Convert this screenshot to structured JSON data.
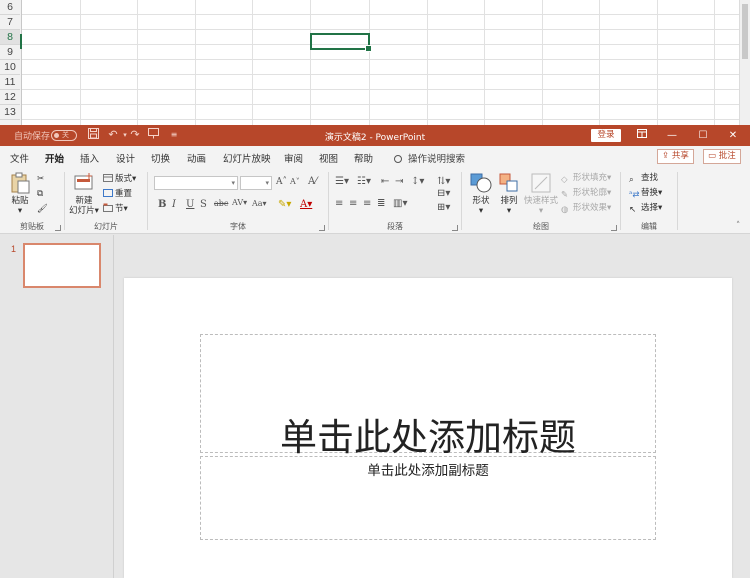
{
  "excel": {
    "rows": [
      "6",
      "7",
      "8",
      "9",
      "10",
      "11",
      "12",
      "13"
    ],
    "active_row": "8"
  },
  "ppt": {
    "autosave_label": "自动保存",
    "autosave_state": "关",
    "doc_title": "演示文稿2  -  PowerPoint",
    "login_label": "登录",
    "tabs": [
      "文件",
      "开始",
      "插入",
      "设计",
      "切换",
      "动画",
      "幻灯片放映",
      "审阅",
      "视图",
      "帮助"
    ],
    "active_tab": "开始",
    "tell_me": "操作说明搜索",
    "share_label": "共享",
    "comments_label": "批注",
    "accent_color": "#b7472a",
    "ribbon": {
      "clipboard": {
        "name": "剪贴板",
        "paste": "粘贴"
      },
      "slides": {
        "name": "幻灯片",
        "new_slide_1": "新建",
        "new_slide_2": "幻灯片",
        "layout": "版式",
        "reset": "重置",
        "section": "节"
      },
      "font": {
        "name": "字体"
      },
      "paragraph": {
        "name": "段落"
      },
      "drawing": {
        "name": "绘图",
        "shapes": "形状",
        "arrange": "排列",
        "quick_styles": "快速样式",
        "shape_fill": "形状填充",
        "shape_outline": "形状轮廓",
        "shape_effects": "形状效果"
      },
      "editing": {
        "name": "编辑",
        "find": "查找",
        "replace": "替换",
        "select": "选择"
      }
    },
    "thumbnail_number": "1",
    "slide": {
      "title_placeholder": "单击此处添加标题",
      "subtitle_placeholder": "单击此处添加副标题"
    }
  }
}
